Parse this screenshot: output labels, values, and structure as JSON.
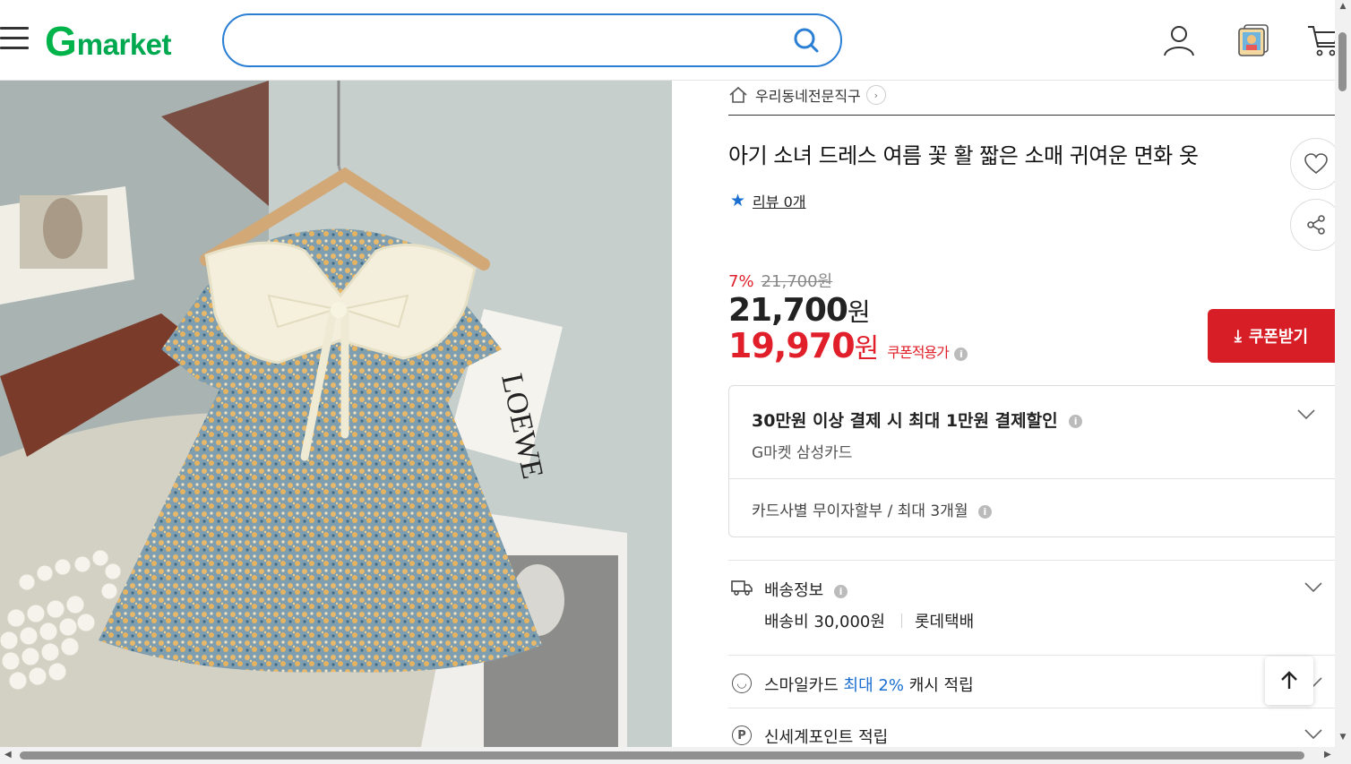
{
  "header": {
    "logo_g": "G",
    "logo_text": "market",
    "search_placeholder": "",
    "icons": [
      "menu-icon",
      "search-icon",
      "user-icon",
      "recent-view-icon",
      "cart-icon"
    ]
  },
  "product": {
    "breadcrumb": "우리동네전문직구",
    "title": "아기 소녀 드레스 여름 꽃 활 짧은 소매 귀여운 면화 옷",
    "review_label": "리뷰 0개",
    "discount_rate": "7%",
    "original_price": "21,700원",
    "price_value": "21,700",
    "price_unit": "원",
    "coupon_price_value": "19,970",
    "coupon_price_unit": "원",
    "coupon_tag": "쿠폰적용가",
    "coupon_button": "쿠폰받기"
  },
  "card_benefit": {
    "title": "30만원 이상 결제 시 최대 1만원 결제할인",
    "card_name": "G마켓 삼성카드",
    "installment": "카드사별 무이자할부 / 최대 3개월"
  },
  "shipping": {
    "label": "배송정보",
    "fee": "배송비 30,000원",
    "carrier": "롯데택배"
  },
  "smile_card": {
    "prefix": "스마일카드",
    "highlight": "최대 2%",
    "suffix": "캐시 적립"
  },
  "shinsegae": {
    "label": "신세계포인트 적립"
  },
  "image": {
    "book_text": "LOEWE"
  },
  "colors": {
    "brand_green": "#00b34a",
    "search_border": "#2a7fd4",
    "sale_red": "#e01f2a",
    "coupon_button": "#d71e26",
    "link_blue": "#1a6fd1"
  }
}
